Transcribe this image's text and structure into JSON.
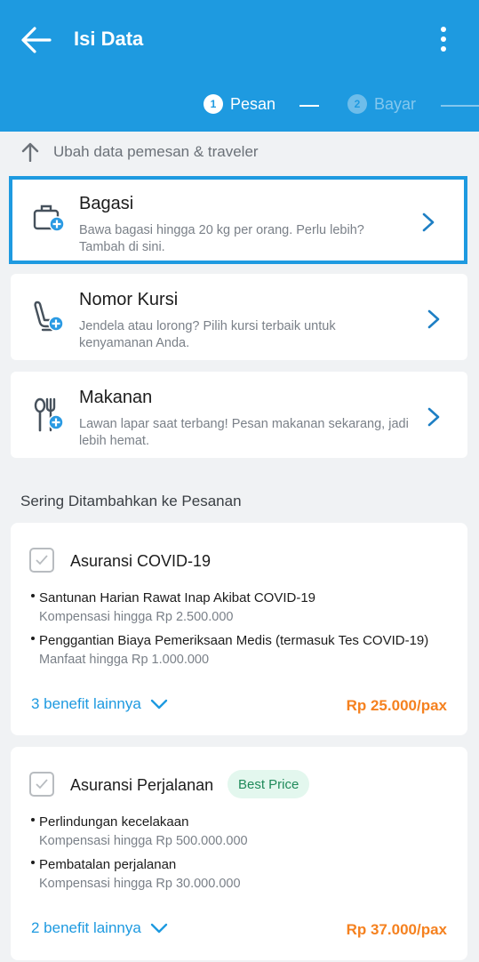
{
  "header": {
    "title": "Isi Data",
    "steps": [
      {
        "num": "1",
        "label": "Pesan",
        "active": true
      },
      {
        "num": "2",
        "label": "Bayar",
        "active": false
      }
    ]
  },
  "edit_link": "Ubah data pemesan & traveler",
  "addons": [
    {
      "title": "Bagasi",
      "desc": "Bawa bagasi hingga 20 kg per orang. Perlu lebih? Tambah di sini.",
      "icon": "luggage-add-icon"
    },
    {
      "title": "Nomor Kursi",
      "desc": "Jendela atau lorong? Pilih kursi terbaik untuk kenyamanan Anda.",
      "icon": "seat-add-icon"
    },
    {
      "title": "Makanan",
      "desc": "Lawan lapar saat terbang! Pesan makanan sekarang, jadi lebih hemat.",
      "icon": "meal-add-icon"
    }
  ],
  "section_title": "Sering Ditambahkan ke Pesanan",
  "insurances": [
    {
      "title": "Asuransi COVID-19",
      "badge": "",
      "benefits": [
        {
          "name": "Santunan Harian Rawat Inap Akibat COVID-19",
          "detail": "Kompensasi hingga Rp 2.500.000"
        },
        {
          "name": "Penggantian Biaya Pemeriksaan Medis (termasuk Tes COVID-19)",
          "detail": "Manfaat hingga Rp 1.000.000"
        }
      ],
      "more": "3 benefit lainnya",
      "price": "Rp 25.000/pax"
    },
    {
      "title": "Asuransi Perjalanan",
      "badge": "Best Price",
      "benefits": [
        {
          "name": "Perlindungan kecelakaan",
          "detail": "Kompensasi hingga Rp 500.000.000"
        },
        {
          "name": "Pembatalan perjalanan",
          "detail": "Kompensasi hingga Rp 30.000.000"
        }
      ],
      "more": "2 benefit lainnya",
      "price": "Rp 37.000/pax"
    }
  ],
  "colors": {
    "primary": "#1e9ae0",
    "price": "#f5811f",
    "badge_bg": "#e3f7ee",
    "badge_text": "#1f8a5a"
  }
}
